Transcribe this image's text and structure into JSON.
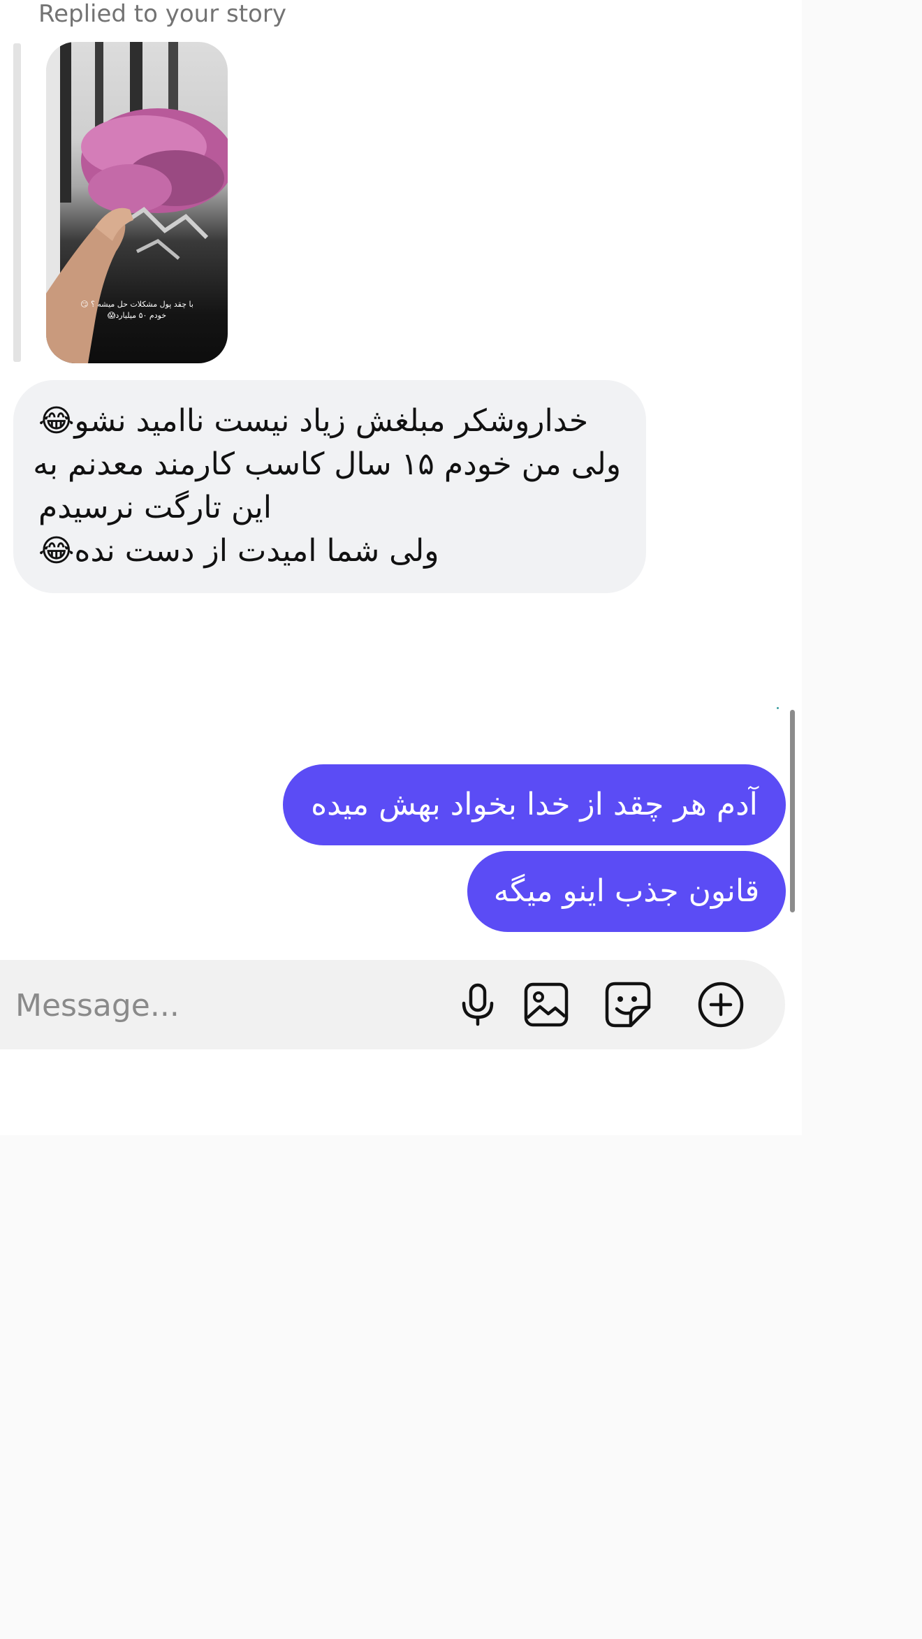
{
  "reply": {
    "label": "Replied to your story",
    "story_caption_lines": [
      "با چقد پول مشکلات حل میشه ؟ 😏",
      "خودم ۵۰ میلیارد😱"
    ]
  },
  "received_message": {
    "lines": [
      "خداروشکر مبلغش زیاد نیست ناامید نشو😂",
      "ولی من خودم ۱۵ سال کاسب کارمند معدنم به",
      "این تارگت نرسیدم",
      "ولی شما امیدت از دست نده😂"
    ]
  },
  "sent_messages": [
    {
      "text": "آدم هر چقد از خدا بخواد بهش میده"
    },
    {
      "text": "قانون جذب اینو میگه"
    }
  ],
  "composer": {
    "placeholder": "Message...",
    "icons": [
      "microphone-icon",
      "image-icon",
      "sticker-icon",
      "add-icon"
    ]
  },
  "colors": {
    "sent_bubble": "#5b4cf5",
    "received_bubble": "#f1f2f4",
    "composer_bg": "#f1f1f1"
  }
}
